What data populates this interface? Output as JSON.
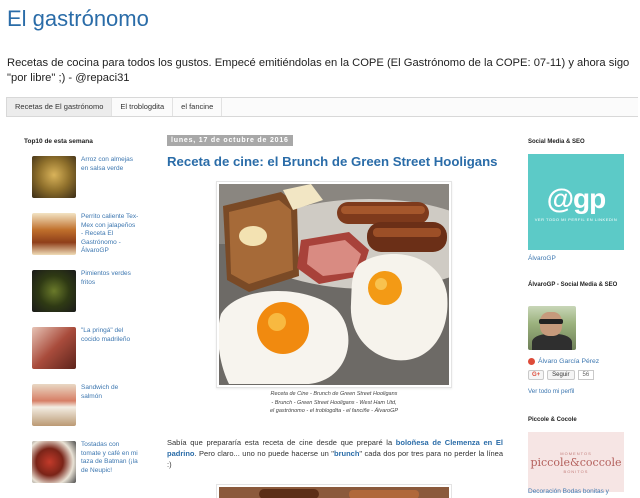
{
  "blog": {
    "title": "El gastrónomo",
    "description": "Recetas de cocina para todos los gustos. Empecé emitiéndolas en la COPE (El Gastrónomo de la COPE: 07-11) y ahora sigo \"por libre\" ;) - @repaci31"
  },
  "tabs": [
    {
      "label": "Recetas de El gastrónomo",
      "active": true
    },
    {
      "label": "El troblogdita",
      "active": false
    },
    {
      "label": "el fancine",
      "active": false
    }
  ],
  "popular": {
    "title": "Top10 de esta semana",
    "items": [
      {
        "label": "Arroz con almejas en salsa verde"
      },
      {
        "label": "Perrito caliente Tex-Mex con jalapeños - Receta El Gastrónomo - ÁlvaroGP"
      },
      {
        "label": "Pimientos verdes fritos"
      },
      {
        "label": "\"La pringá\" del cocido madrileño"
      },
      {
        "label": "Sandwich de salmón"
      },
      {
        "label": "Tostadas con tomate y café en mi taza de Batman (¡la de Neupic!"
      }
    ]
  },
  "post": {
    "date": "lunes, 17 de octubre de 2016",
    "title": "Receta de cine: el Brunch de Green Street Hooligans",
    "caption_lines": [
      "Receta de Cine - Brunch de Green Street Hooligans",
      "- Brunch - Green Street Hooligans - West Ham Utd,",
      "el gastrónomo - el troblogdita - el fanciñe - ÁlvaroGP"
    ],
    "body_part1": "Sabía que prepararía esta receta de cine desde que preparé la ",
    "body_link1": "boloñesa de Clemenza en El padrino",
    "body_part2": ". Pero claro... uno no puede hacerse un \"",
    "body_link2": "brunch",
    "body_part3": "\" cada dos por tres para no perder la línea :)"
  },
  "sidebar": {
    "social_title": "Social Media & SEO",
    "logo_mark": "@gp",
    "logo_sub": "VER TODO MI PERFIL EN LINKEDIN",
    "logo_link": "ÁlvaroGP",
    "profile_title": "ÁlvaroGP - Social Media & SEO",
    "profile_name": "Álvaro García Pérez",
    "follow_g": "G+",
    "follow_label": "Seguir",
    "follow_count": "56",
    "view_profile": "Ver todo mi perfil",
    "piccole_title": "Piccole & Cocole",
    "piccole_top": "MOMENTOS",
    "piccole_mid": "piccole&coccole",
    "piccole_bot": "BONITOS",
    "piccole_link": "Decoración Bodas bonitas y"
  },
  "colors": {
    "title_blue": "#2a6ca8",
    "link_blue": "#3d77b0",
    "logo_teal": "#5ccac7",
    "date_grey": "#a8a8a8"
  }
}
